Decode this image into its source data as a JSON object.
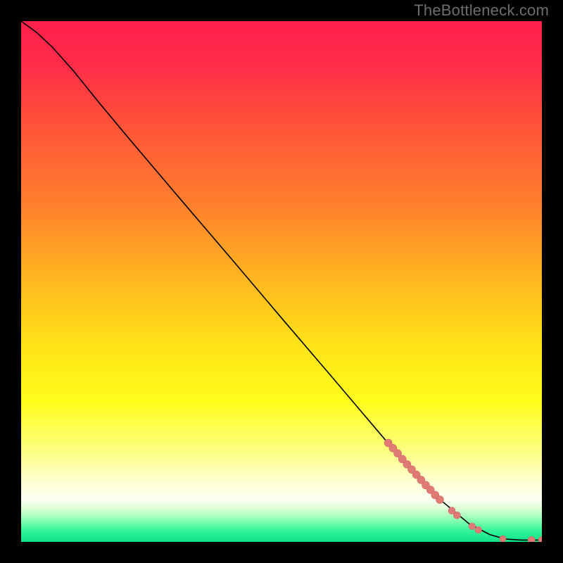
{
  "watermark": "TheBottleneck.com",
  "colors": {
    "gradient_stops": [
      {
        "offset": 0.0,
        "color": "#ff1f4b"
      },
      {
        "offset": 0.08,
        "color": "#ff2b49"
      },
      {
        "offset": 0.2,
        "color": "#ff5338"
      },
      {
        "offset": 0.35,
        "color": "#ff7f2d"
      },
      {
        "offset": 0.5,
        "color": "#ffb81f"
      },
      {
        "offset": 0.62,
        "color": "#ffe318"
      },
      {
        "offset": 0.73,
        "color": "#fffd1b"
      },
      {
        "offset": 0.82,
        "color": "#fcff7a"
      },
      {
        "offset": 0.885,
        "color": "#ffffd4"
      },
      {
        "offset": 0.918,
        "color": "#fbfff2"
      },
      {
        "offset": 0.938,
        "color": "#d8ffd3"
      },
      {
        "offset": 0.958,
        "color": "#8bffb2"
      },
      {
        "offset": 0.978,
        "color": "#35f59a"
      },
      {
        "offset": 1.0,
        "color": "#11e28a"
      }
    ],
    "curve": "#000000",
    "marker_fill": "#e07a74",
    "marker_stroke": "#cf6b66"
  },
  "chart_data": {
    "type": "line",
    "title": "",
    "xlabel": "",
    "ylabel": "",
    "xlim": [
      0,
      100
    ],
    "ylim": [
      0,
      100
    ],
    "curve": [
      {
        "x": 0.0,
        "y": 100.0
      },
      {
        "x": 3.0,
        "y": 97.8
      },
      {
        "x": 6.0,
        "y": 95.0
      },
      {
        "x": 10.0,
        "y": 90.5
      },
      {
        "x": 15.0,
        "y": 84.3
      },
      {
        "x": 20.0,
        "y": 78.3
      },
      {
        "x": 30.0,
        "y": 66.5
      },
      {
        "x": 40.0,
        "y": 54.8
      },
      {
        "x": 50.0,
        "y": 43.0
      },
      {
        "x": 60.0,
        "y": 31.3
      },
      {
        "x": 70.0,
        "y": 19.5
      },
      {
        "x": 80.0,
        "y": 8.5
      },
      {
        "x": 86.0,
        "y": 3.5
      },
      {
        "x": 90.0,
        "y": 1.4
      },
      {
        "x": 93.0,
        "y": 0.55
      },
      {
        "x": 96.0,
        "y": 0.35
      },
      {
        "x": 100.0,
        "y": 0.35
      }
    ],
    "series": [
      {
        "name": "markers",
        "points": [
          {
            "x": 70.5,
            "y": 19.0,
            "r": 5.5
          },
          {
            "x": 71.4,
            "y": 18.0,
            "r": 5.5
          },
          {
            "x": 72.3,
            "y": 17.0,
            "r": 5.5
          },
          {
            "x": 73.2,
            "y": 15.9,
            "r": 5.5
          },
          {
            "x": 74.1,
            "y": 14.9,
            "r": 5.5
          },
          {
            "x": 75.0,
            "y": 13.9,
            "r": 5.5
          },
          {
            "x": 75.9,
            "y": 12.9,
            "r": 5.5
          },
          {
            "x": 76.8,
            "y": 11.9,
            "r": 5.5
          },
          {
            "x": 77.7,
            "y": 10.9,
            "r": 5.5
          },
          {
            "x": 78.6,
            "y": 10.0,
            "r": 5.5
          },
          {
            "x": 79.5,
            "y": 9.0,
            "r": 5.5
          },
          {
            "x": 80.4,
            "y": 8.1,
            "r": 5.5
          },
          {
            "x": 82.7,
            "y": 6.0,
            "r": 5.0
          },
          {
            "x": 83.7,
            "y": 5.1,
            "r": 5.0
          },
          {
            "x": 86.6,
            "y": 3.0,
            "r": 4.8
          },
          {
            "x": 87.8,
            "y": 2.3,
            "r": 4.8
          },
          {
            "x": 92.5,
            "y": 0.6,
            "r": 4.5
          },
          {
            "x": 98.0,
            "y": 0.35,
            "r": 5.0
          },
          {
            "x": 100.0,
            "y": 0.35,
            "r": 5.0
          }
        ]
      }
    ]
  }
}
